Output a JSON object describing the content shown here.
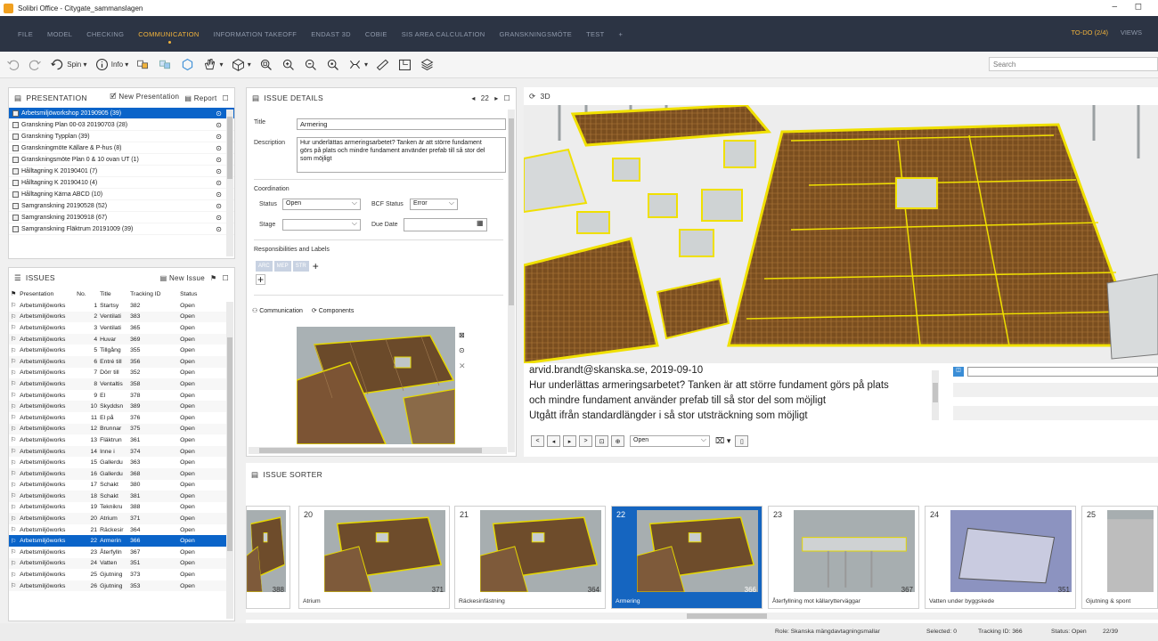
{
  "window": {
    "title": "Solibri Office - Citygate_sammanslagen"
  },
  "menu": {
    "tabs": [
      "FILE",
      "MODEL",
      "CHECKING",
      "COMMUNICATION",
      "INFORMATION TAKEOFF",
      "ENDAST 3D",
      "COBIE",
      "SIS AREA CALCULATION",
      "GRANSKNINGSMÖTE",
      "TEST",
      "+"
    ],
    "active": "COMMUNICATION",
    "todo": "TO-DO (2/4)",
    "views": "VIEWS"
  },
  "toolbar": {
    "spin_label": "Spin",
    "info_label": "Info",
    "search_placeholder": "Search"
  },
  "presentation": {
    "title": "PRESENTATION",
    "new_label": "New Presentation",
    "report_label": "Report",
    "items": [
      "Arbetsmiljöworkshop 20190905 (39)",
      "Granskning Plan 00-03 20190703 (28)",
      "Granskning Typplan (39)",
      "Granskningmöte Källare & P-hus (8)",
      "Granskningsmöte Plan 0 & 10 ovan UT (1)",
      "Hålltagning K 20190401 (7)",
      "Hålltagning K 20190410 (4)",
      "Hålltagning Kärna ABCD (10)",
      "Samgranskning 20190528 (52)",
      "Samgranskning 20190918 (67)",
      "Samgranskning Fläktrum 20191009 (39)"
    ]
  },
  "issues": {
    "title": "ISSUES",
    "new_label": "New Issue",
    "columns": [
      "Presentation",
      "No.",
      "Title",
      "Tracking ID",
      "Status"
    ],
    "rows": [
      [
        "Arbetsmiljöworks",
        "1",
        "Startsy",
        "382",
        "Open"
      ],
      [
        "Arbetsmiljöworks",
        "2",
        "Ventilati",
        "383",
        "Open"
      ],
      [
        "Arbetsmiljöworks",
        "3",
        "Ventilati",
        "365",
        "Open"
      ],
      [
        "Arbetsmiljöworks",
        "4",
        "Huvar",
        "369",
        "Open"
      ],
      [
        "Arbetsmiljöworks",
        "5",
        "Tillgång",
        "355",
        "Open"
      ],
      [
        "Arbetsmiljöworks",
        "6",
        "Entré till",
        "356",
        "Open"
      ],
      [
        "Arbetsmiljöworks",
        "7",
        "Dörr till",
        "352",
        "Open"
      ],
      [
        "Arbetsmiljöworks",
        "8",
        "Ventaltis",
        "358",
        "Open"
      ],
      [
        "Arbetsmiljöworks",
        "9",
        "El",
        "378",
        "Open"
      ],
      [
        "Arbetsmiljöworks",
        "10",
        "Skyddsn",
        "389",
        "Open"
      ],
      [
        "Arbetsmiljöworks",
        "11",
        "El på",
        "376",
        "Open"
      ],
      [
        "Arbetsmiljöworks",
        "12",
        "Brunnar",
        "375",
        "Open"
      ],
      [
        "Arbetsmiljöworks",
        "13",
        "Fläktrun",
        "361",
        "Open"
      ],
      [
        "Arbetsmiljöworks",
        "14",
        "Inne i",
        "374",
        "Open"
      ],
      [
        "Arbetsmiljöworks",
        "15",
        "Gallerdu",
        "363",
        "Open"
      ],
      [
        "Arbetsmiljöworks",
        "16",
        "Gallerdu",
        "368",
        "Open"
      ],
      [
        "Arbetsmiljöworks",
        "17",
        "Schakt",
        "380",
        "Open"
      ],
      [
        "Arbetsmiljöworks",
        "18",
        "Schakt",
        "381",
        "Open"
      ],
      [
        "Arbetsmiljöworks",
        "19",
        "Teknikru",
        "388",
        "Open"
      ],
      [
        "Arbetsmiljöworks",
        "20",
        "Atrium",
        "371",
        "Open"
      ],
      [
        "Arbetsmiljöworks",
        "21",
        "Räckesir",
        "364",
        "Open"
      ],
      [
        "Arbetsmiljöworks",
        "22",
        "Armerin",
        "366",
        "Open"
      ],
      [
        "Arbetsmiljöworks",
        "23",
        "Återfylln",
        "367",
        "Open"
      ],
      [
        "Arbetsmiljöworks",
        "24",
        "Vatten",
        "351",
        "Open"
      ],
      [
        "Arbetsmiljöworks",
        "25",
        "Gjutning",
        "373",
        "Open"
      ],
      [
        "Arbetsmiljöworks",
        "26",
        "Gjutning",
        "353",
        "Open"
      ]
    ],
    "selected_index": 21
  },
  "issue_details": {
    "title": "ISSUE DETAILS",
    "nav_number": "22",
    "title_label": "Title",
    "title_value": "Armering",
    "description_label": "Description",
    "description": "Hur underlättas armeringsarbetet? Tanken är att större fundament görs på plats och mindre fundament använder prefab till så stor del som möjligt",
    "coordination_label": "Coordination",
    "status_label": "Status",
    "status_value": "Open",
    "bcf_status_label": "BCF Status",
    "bcf_status_value": "Error",
    "stage_label": "Stage",
    "due_date_label": "Due Date",
    "responsibilities_label": "Responsibilities and Labels",
    "labels": [
      "ARC",
      "MEP",
      "STR"
    ],
    "tab_communication": "Communication",
    "tab_components": "Components"
  },
  "view3d": {
    "title": "3D",
    "comment_author": "arvid.brandt@skanska.se, 2019-09-10",
    "comment_lines": [
      "Hur underlättas armeringsarbetet? Tanken är att större fundament görs på plats",
      "och mindre fundament använder prefab till så stor del som möjligt",
      "Utgått ifrån standardlängder i så stor utsträckning som möjligt"
    ],
    "status_value": "Open"
  },
  "sorter": {
    "title": "ISSUE SORTER",
    "cards": [
      {
        "num": "",
        "caption": "",
        "tid": "388"
      },
      {
        "num": "20",
        "caption": "Atrium",
        "tid": "371"
      },
      {
        "num": "21",
        "caption": "Räckesinfästning",
        "tid": "364"
      },
      {
        "num": "22",
        "caption": "Armering",
        "tid": "366"
      },
      {
        "num": "23",
        "caption": "Återfyllning mot källarytterväggar",
        "tid": "367"
      },
      {
        "num": "24",
        "caption": "Vatten under byggskede",
        "tid": "351"
      },
      {
        "num": "25",
        "caption": "Gjutning & spont",
        "tid": ""
      }
    ]
  },
  "status": {
    "role": "Role: Skanska mängdavtagningsmallar",
    "selected": "Selected: 0",
    "tracking": "Tracking ID: 366",
    "status": "Status: Open",
    "count": "22/39"
  },
  "colors": {
    "accent": "#f3b43c",
    "menubar": "#2c3444",
    "selection": "#0a64c9",
    "highlight": "#f0e000"
  }
}
